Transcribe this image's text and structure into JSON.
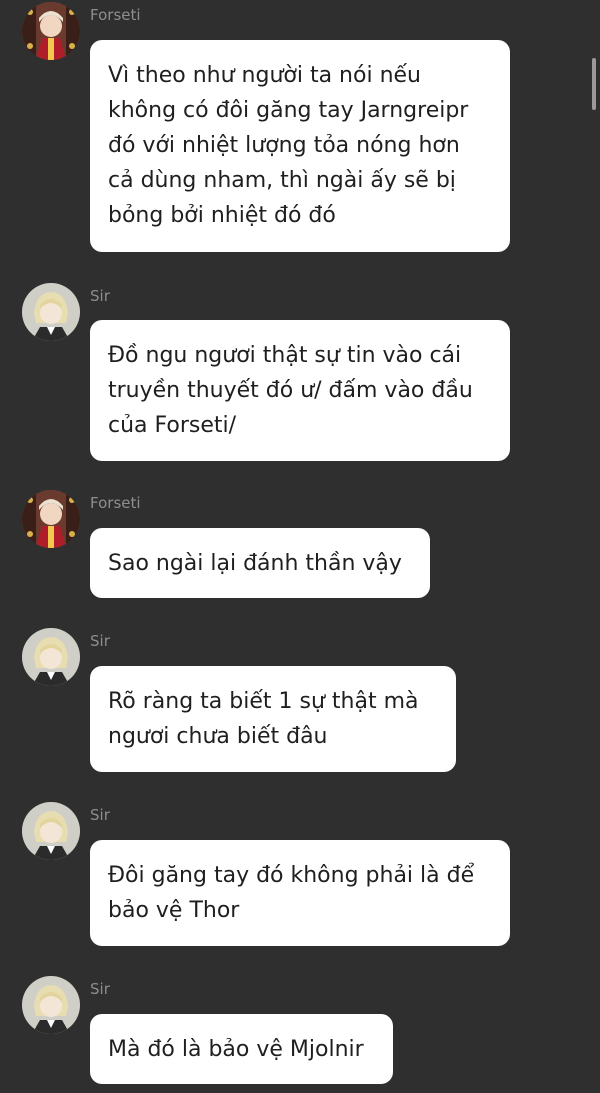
{
  "colors": {
    "background": "#2f2f2f",
    "bubble": "#ffffff",
    "bubble_text": "#1f1f1f",
    "name_text": "#8e8e8e"
  },
  "messages": [
    {
      "sender": "Forseti",
      "avatar_icon": "forseti-avatar-icon",
      "text": "Vì theo như người ta nói nếu\nkhông có đôi găng tay Jarngreipr\nđó với nhiệt lượng tỏa nóng hơn\ncả dùng nham, thì ngài ấy sẽ bị\nbỏng bởi nhiệt đó đó"
    },
    {
      "sender": "Sir",
      "avatar_icon": "sir-avatar-icon",
      "text": "Đồ ngu ngươi thật sự tin vào cái\ntruyền thuyết đó ư/ đấm vào đầu\ncủa Forseti/"
    },
    {
      "sender": "Forseti",
      "avatar_icon": "forseti-avatar-icon",
      "text": "Sao ngài lại đánh thần vậy"
    },
    {
      "sender": "Sir",
      "avatar_icon": "sir-avatar-icon",
      "text": "Rõ ràng ta biết 1 sự thật mà\nngươi chưa biết đâu"
    },
    {
      "sender": "Sir",
      "avatar_icon": "sir-avatar-icon",
      "text": "Đôi găng tay đó không phải là để\nbảo vệ Thor"
    },
    {
      "sender": "Sir",
      "avatar_icon": "sir-avatar-icon",
      "text": "Mà đó là bảo vệ Mjolnir"
    }
  ]
}
